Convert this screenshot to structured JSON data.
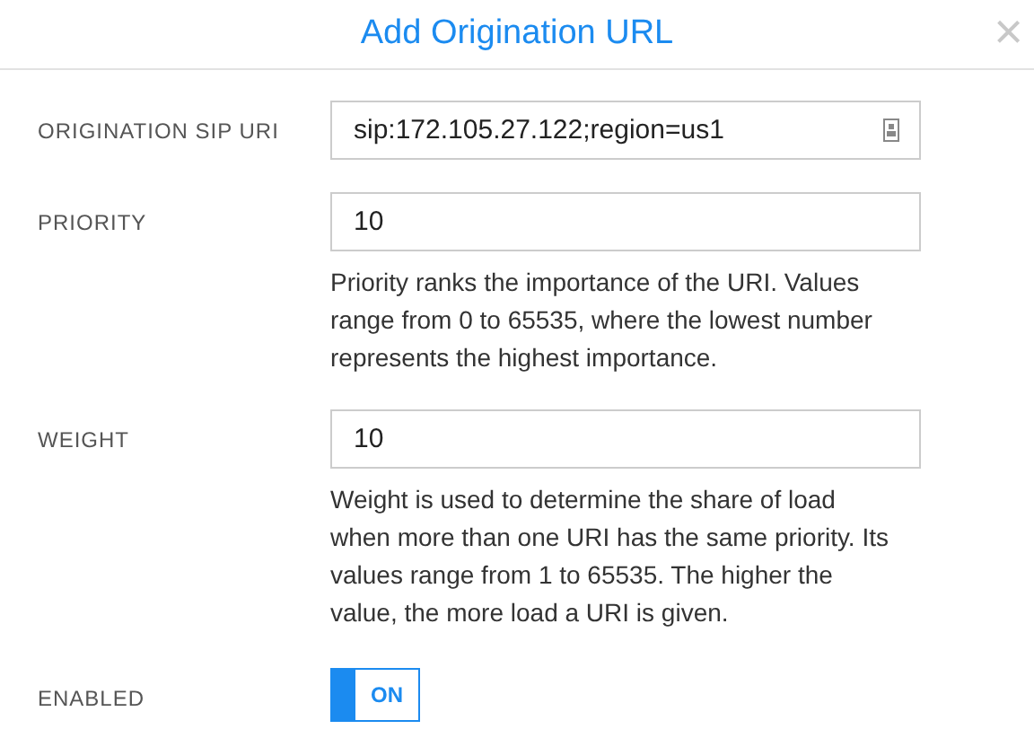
{
  "dialog": {
    "title": "Add Origination URL",
    "close": "×"
  },
  "fields": [
    {
      "kind": "input",
      "label": "ORIGINATION SIP URI",
      "value": "sip:172.105.27.122;region=us1",
      "autofill_icon": true
    },
    {
      "kind": "input",
      "label": "PRIORITY",
      "value": "10",
      "help": "Priority ranks the importance of the URI. Values range from 0 to 65535, where the lowest number represents the highest importance."
    },
    {
      "kind": "input",
      "label": "WEIGHT",
      "value": "10",
      "help": "Weight is used to determine the share of load when more than one URI has the same priority. Its values range from 1 to 65535. The higher the value, the more load a URI is given."
    },
    {
      "kind": "toggle",
      "label": "ENABLED",
      "on": true,
      "state_label": "ON"
    }
  ]
}
